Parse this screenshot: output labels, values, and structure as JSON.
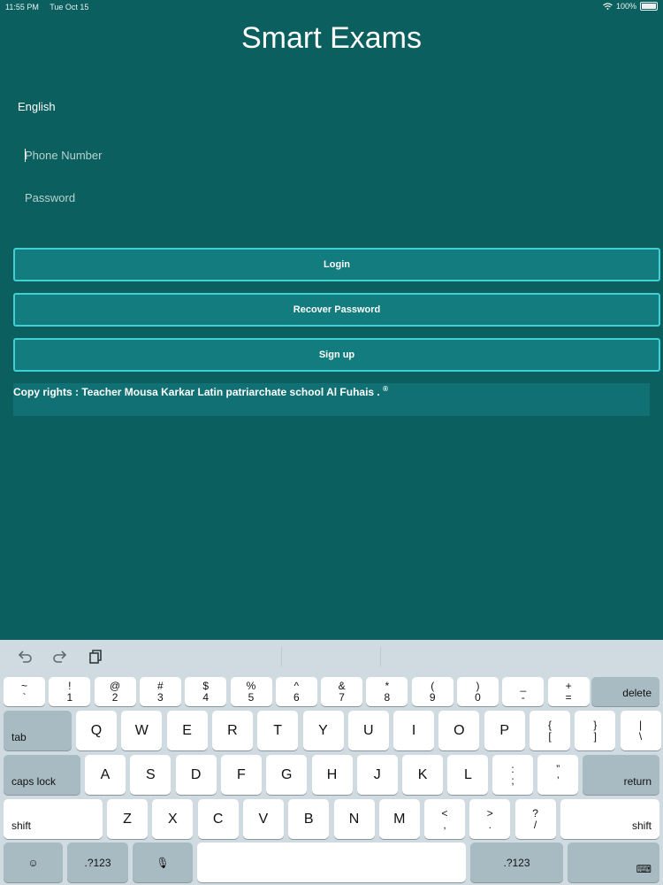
{
  "status": {
    "time": "11:55 PM",
    "date": "Tue Oct 15",
    "battery": "100%"
  },
  "app": {
    "title": "Smart Exams"
  },
  "language": "English",
  "form": {
    "phone_placeholder": "Phone Number",
    "password_placeholder": "Password"
  },
  "buttons": {
    "login": "Login",
    "recover": "Recover Password",
    "signup": "Sign up"
  },
  "copyright": "Copy rights : Teacher Mousa Karkar   Latin patriarchate school Al Fuhais .",
  "copyright_mark": "®",
  "keyboard": {
    "row1": [
      {
        "top": "~",
        "bottom": "`"
      },
      {
        "top": "!",
        "bottom": "1"
      },
      {
        "top": "@",
        "bottom": "2"
      },
      {
        "top": "#",
        "bottom": "3"
      },
      {
        "top": "$",
        "bottom": "4"
      },
      {
        "top": "%",
        "bottom": "5"
      },
      {
        "top": "^",
        "bottom": "6"
      },
      {
        "top": "&",
        "bottom": "7"
      },
      {
        "top": "*",
        "bottom": "8"
      },
      {
        "top": "(",
        "bottom": "9"
      },
      {
        "top": ")",
        "bottom": "0"
      },
      {
        "top": "_",
        "bottom": "-"
      },
      {
        "top": "+",
        "bottom": "="
      }
    ],
    "delete": "delete",
    "tab": "tab",
    "row2": [
      "Q",
      "W",
      "E",
      "R",
      "T",
      "Y",
      "U",
      "I",
      "O",
      "P"
    ],
    "row2_sym": [
      {
        "top": "{",
        "bottom": "["
      },
      {
        "top": "}",
        "bottom": "]"
      },
      {
        "top": "|",
        "bottom": "\\"
      }
    ],
    "caps": "caps lock",
    "row3": [
      "A",
      "S",
      "D",
      "F",
      "G",
      "H",
      "J",
      "K",
      "L"
    ],
    "row3_sym": [
      {
        "top": ":",
        "bottom": ";"
      },
      {
        "top": "”",
        "bottom": "’"
      }
    ],
    "return": "return",
    "shift": "shift",
    "row4": [
      "Z",
      "X",
      "C",
      "V",
      "B",
      "N",
      "M"
    ],
    "row4_sym": [
      {
        "top": "<",
        "bottom": ","
      },
      {
        "top": ">",
        "bottom": "."
      },
      {
        "top": "?",
        "bottom": "/"
      }
    ],
    "num": ".?123",
    "emoji": "☺",
    "mic": "🎙",
    "hide": "⌨"
  },
  "icons": {
    "undo": "undo-icon",
    "redo": "redo-icon",
    "paste": "paste-icon",
    "wifi": "wifi-icon",
    "battery": "battery-icon"
  }
}
